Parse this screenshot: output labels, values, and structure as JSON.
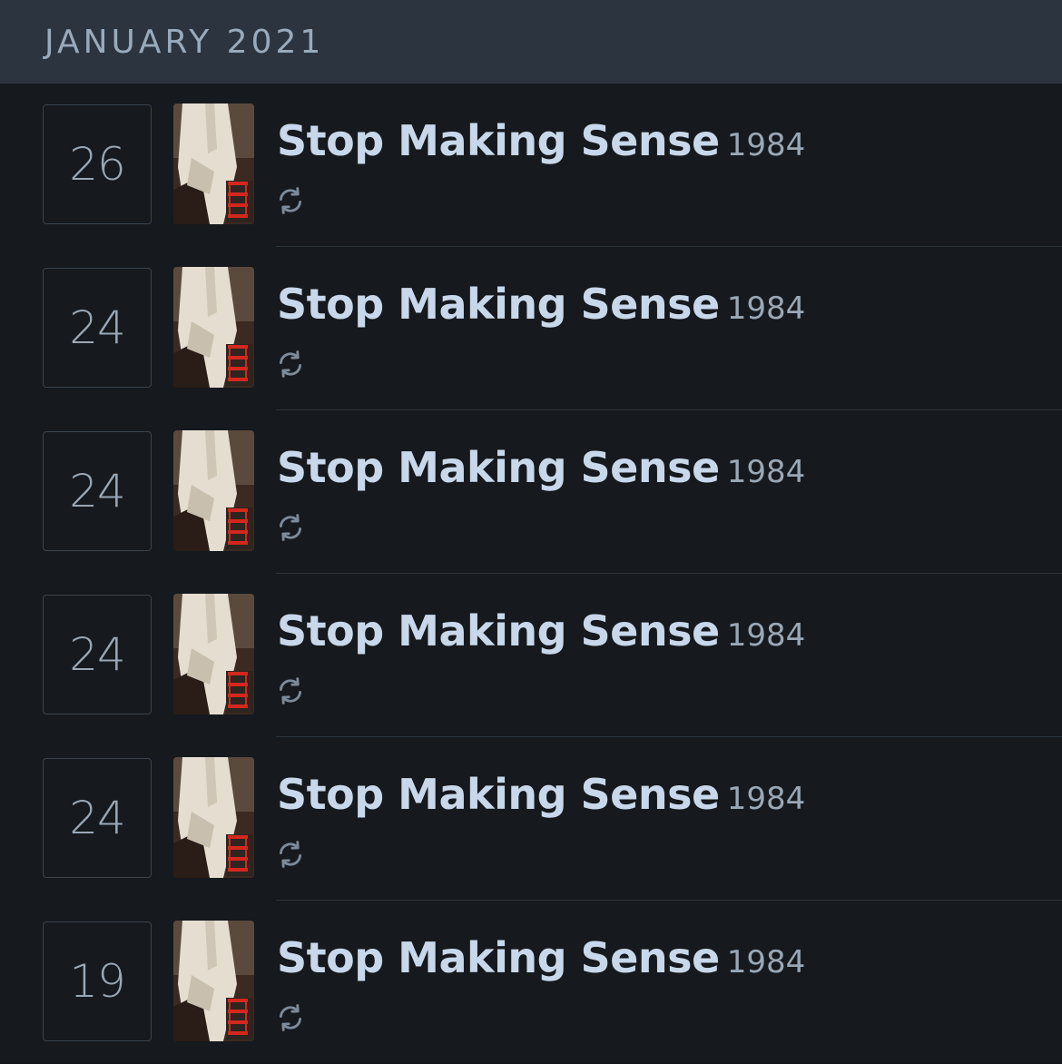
{
  "month_header": {
    "label": "JANUARY 2021"
  },
  "entries": [
    {
      "day": "26",
      "title": "Stop Making Sense",
      "year": "1984",
      "rewatch": true
    },
    {
      "day": "24",
      "title": "Stop Making Sense",
      "year": "1984",
      "rewatch": true
    },
    {
      "day": "24",
      "title": "Stop Making Sense",
      "year": "1984",
      "rewatch": true
    },
    {
      "day": "24",
      "title": "Stop Making Sense",
      "year": "1984",
      "rewatch": true
    },
    {
      "day": "24",
      "title": "Stop Making Sense",
      "year": "1984",
      "rewatch": true
    },
    {
      "day": "19",
      "title": "Stop Making Sense",
      "year": "1984",
      "rewatch": true
    }
  ],
  "icons": {
    "rewatch": "rewatch-icon",
    "poster": "poster-image"
  },
  "colors": {
    "header_bg": "#2c3440",
    "list_bg": "#16191d",
    "title": "#c8d8ea",
    "secondary": "#9aa8b6",
    "border": "#3a4450",
    "poster_red": "#d2281e"
  }
}
